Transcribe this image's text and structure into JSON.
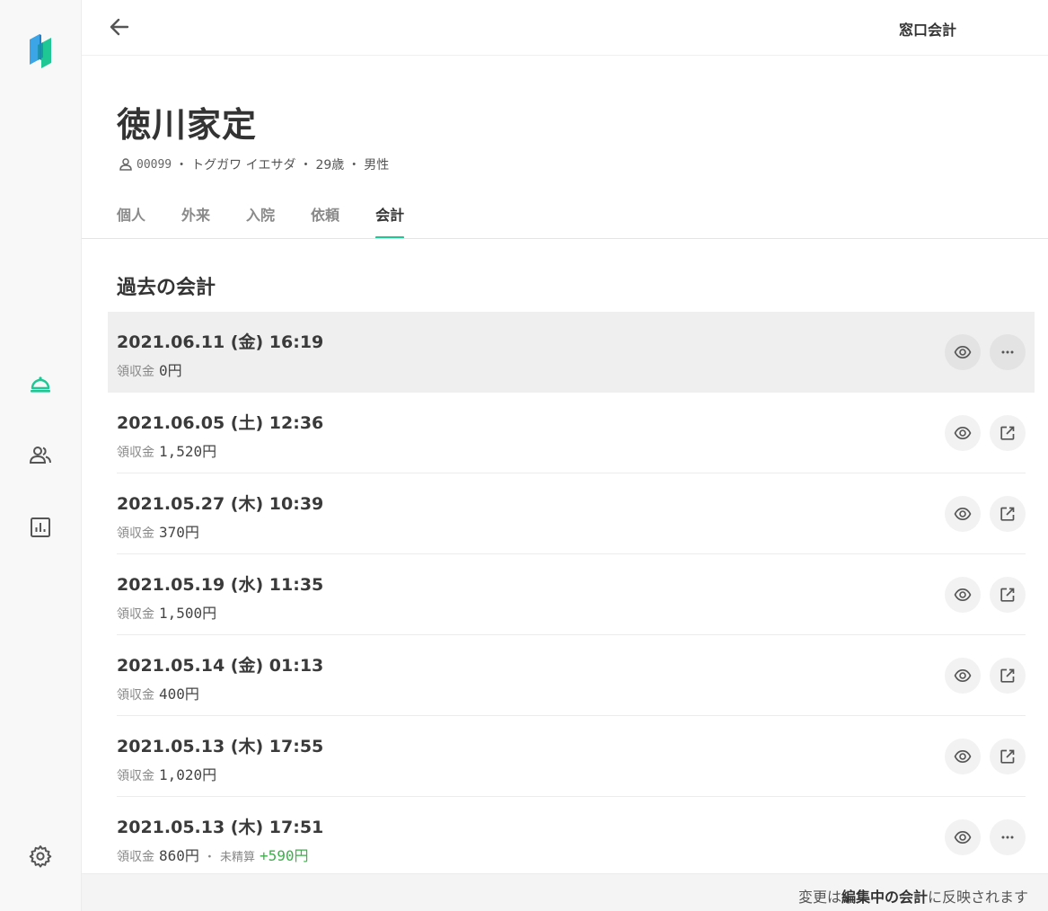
{
  "topbar": {
    "title": "窓口会計"
  },
  "patient": {
    "name": "徳川家定",
    "id": "00099",
    "kana": "トグガワ イエサダ",
    "age": "29歳",
    "sex": "男性",
    "sep": "・"
  },
  "tabs": [
    {
      "label": "個人"
    },
    {
      "label": "外来"
    },
    {
      "label": "入院"
    },
    {
      "label": "依頼"
    },
    {
      "label": "会計",
      "active": true
    }
  ],
  "section": {
    "title": "過去の会計"
  },
  "payments": [
    {
      "date": "2021.06.11 (金) 16:19",
      "label": "領収金",
      "amount": "0",
      "unit": "円",
      "action": "more"
    },
    {
      "date": "2021.06.05 (土) 12:36",
      "label": "領収金",
      "amount": "1,520",
      "unit": "円",
      "action": "open"
    },
    {
      "date": "2021.05.27 (木) 10:39",
      "label": "領収金",
      "amount": "370",
      "unit": "円",
      "action": "open"
    },
    {
      "date": "2021.05.19 (水) 11:35",
      "label": "領収金",
      "amount": "1,500",
      "unit": "円",
      "action": "open"
    },
    {
      "date": "2021.05.14 (金) 01:13",
      "label": "領収金",
      "amount": "400",
      "unit": "円",
      "action": "open"
    },
    {
      "date": "2021.05.13 (木) 17:55",
      "label": "領収金",
      "amount": "1,020",
      "unit": "円",
      "action": "open"
    },
    {
      "date": "2021.05.13 (木) 17:51",
      "label": "領収金",
      "amount": "860",
      "unit": "円",
      "unpaid_label": "未精算",
      "unpaid_amount": "+590円",
      "action": "more"
    }
  ],
  "footer": {
    "pre": "変更は",
    "bold": "編集中の会計",
    "post": "に反映されます"
  },
  "colors": {
    "accent": "#1ec794",
    "positive": "#3cb04a"
  }
}
